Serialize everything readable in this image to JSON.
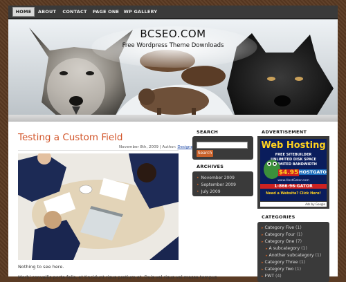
{
  "nav": {
    "items": [
      {
        "label": "HOME",
        "active": true
      },
      {
        "label": "ABOUT"
      },
      {
        "label": "CONTACT"
      },
      {
        "label": "PAGE ONE"
      },
      {
        "label": "WP GALLERY"
      }
    ]
  },
  "header": {
    "site_title": "BCSEO.COM",
    "tagline": "Free Wordpress Theme Downloads"
  },
  "post": {
    "title": "Testing a Custom Field",
    "meta_date": "November 8th, 2009 | Author:",
    "meta_author": "Designer",
    "text_1": "Nothing to see here.",
    "text_2": "Morbi convallis porta felis, et tincidunt risus pretium et. Duis vel risus vel massa tempus"
  },
  "search": {
    "title": "SEARCH",
    "button_label": "Search",
    "value": ""
  },
  "archives": {
    "title": "ARCHIVES",
    "items": [
      "November 2009",
      "September 2009",
      "July 2009"
    ]
  },
  "advertisement": {
    "title": "ADVERTISEMENT",
    "headline": "Web Hosting",
    "lines": [
      "FREE SITEBUILDER",
      "UNLIMITED DISK SPACE",
      "UNLIMITED BANDWIDTH"
    ],
    "price": "$4.95",
    "brand": "HOSTGATOR",
    "url": "www.HostGator.com",
    "phone": "1-866-96-GATOR",
    "cta": "Need a Website? Click Here!",
    "footer": "Ads by Google"
  },
  "categories": {
    "title": "CATEGORIES",
    "items": [
      {
        "label": "Category Five",
        "count": "(1)",
        "level": 0
      },
      {
        "label": "Category Four",
        "count": "(1)",
        "level": 0
      },
      {
        "label": "Category One",
        "count": "(7)",
        "level": 0
      },
      {
        "label": "A subcategory",
        "count": "(1)",
        "level": 1
      },
      {
        "label": "Another subcategory",
        "count": "(1)",
        "level": 1
      },
      {
        "label": "Category Three",
        "count": "(1)",
        "level": 0
      },
      {
        "label": "Category Two",
        "count": "(1)",
        "level": 0
      },
      {
        "label": "FWT",
        "count": "(4)",
        "level": 0
      }
    ]
  },
  "colors": {
    "accent": "#c9622b",
    "title": "#d2552a",
    "widget_bg": "#3a3a3a",
    "page_bg": "#5b3a22"
  }
}
